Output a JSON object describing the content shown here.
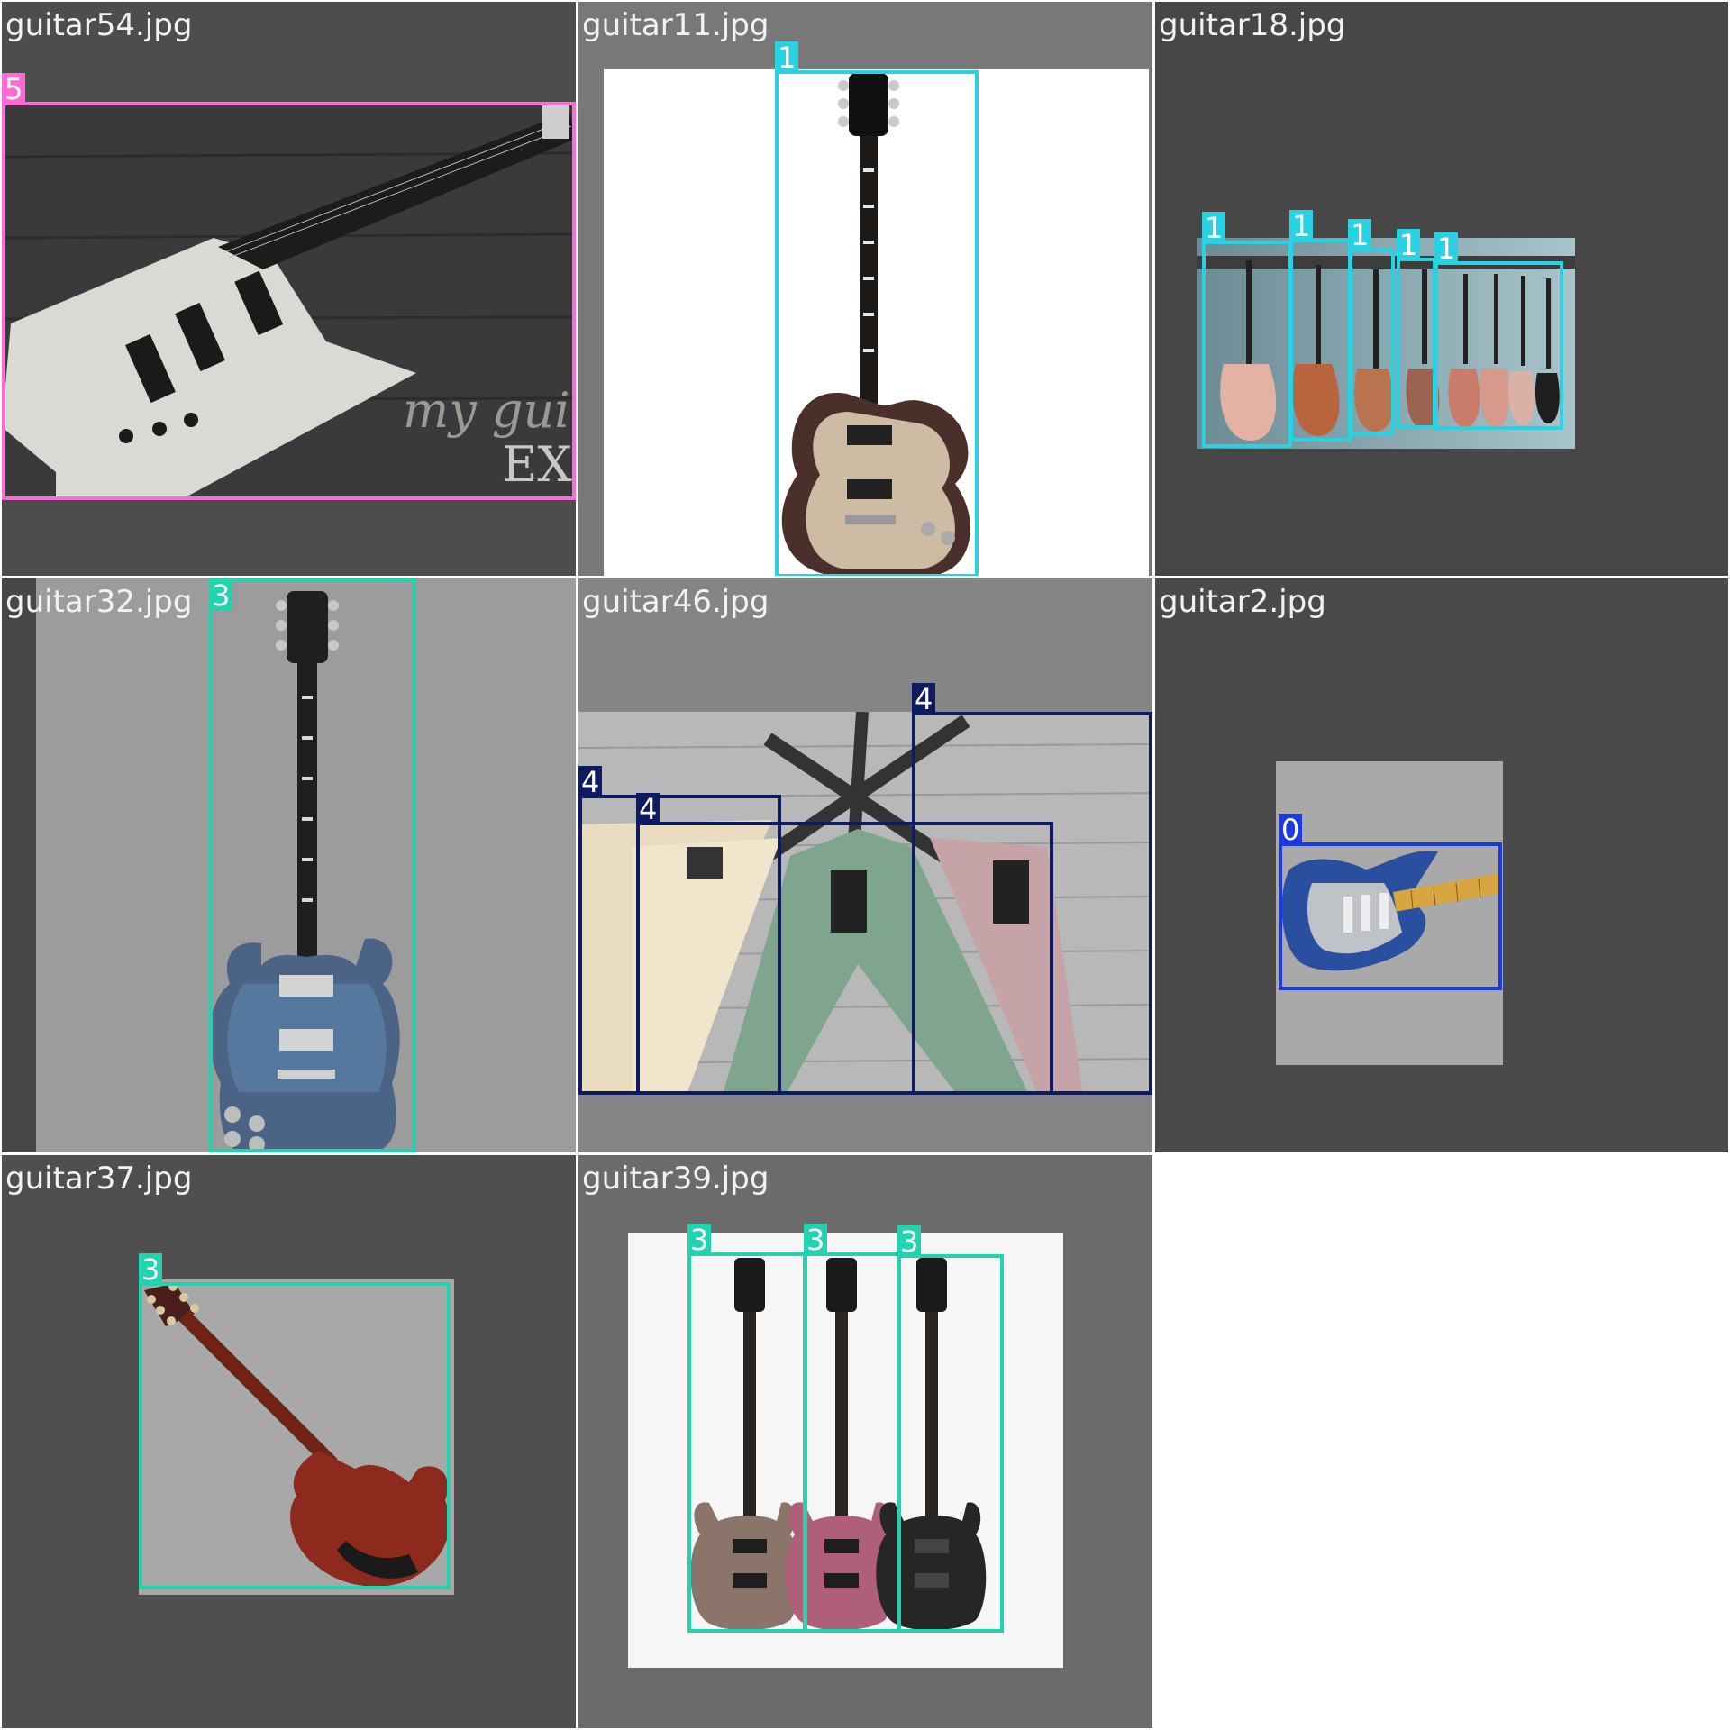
{
  "grid": {
    "background": "#ffffff",
    "tiles": [
      {
        "filename": "guitar54.jpg",
        "background": "#4d4d4d",
        "image": {
          "content": "white-explorer-guitar-on-dark-wood",
          "background": "#3b3b3b"
        },
        "boxes": [
          {
            "class_id": "5",
            "color": "#ff6bd6"
          }
        ]
      },
      {
        "filename": "guitar11.jpg",
        "background": "#787878",
        "image": {
          "content": "sunburst-les-paul-guitar-on-white",
          "background": "#ffffff"
        },
        "boxes": [
          {
            "class_id": "1",
            "color": "#28d2e0"
          }
        ]
      },
      {
        "filename": "guitar18.jpg",
        "background": "#474747",
        "image": {
          "content": "row-of-guitars-hanging-on-wall",
          "background": "#6f8e98"
        },
        "boxes": [
          {
            "class_id": "1",
            "color": "#28d2e0"
          },
          {
            "class_id": "1",
            "color": "#28d2e0"
          },
          {
            "class_id": "1",
            "color": "#28d2e0"
          },
          {
            "class_id": "1",
            "color": "#28d2e0"
          },
          {
            "class_id": "1",
            "color": "#28d2e0"
          }
        ]
      },
      {
        "filename": "guitar32.jpg",
        "background": "#474747",
        "image": {
          "content": "blue-burst-sg-guitar-on-grey",
          "background": "#9c9c9c"
        },
        "boxes": [
          {
            "class_id": "3",
            "color": "#21d3ae"
          }
        ]
      },
      {
        "filename": "guitar46.jpg",
        "background": "#858585",
        "image": {
          "content": "three-flying-v-guitars-on-wood",
          "background": "#b9b9b9"
        },
        "boxes": [
          {
            "class_id": "4",
            "color": "#0e1b5e"
          },
          {
            "class_id": "4",
            "color": "#0e1b5e"
          },
          {
            "class_id": "4",
            "color": "#0e1b5e"
          }
        ]
      },
      {
        "filename": "guitar2.jpg",
        "background": "#4a4a4a",
        "image": {
          "content": "blue-stratocaster-guitar",
          "background": "#a9a9a9"
        },
        "boxes": [
          {
            "class_id": "0",
            "color": "#1d3ae0"
          }
        ]
      },
      {
        "filename": "guitar37.jpg",
        "background": "#4f4f4f",
        "image": {
          "content": "red-sg-guitar-back-view",
          "background": "#a8a8a8"
        },
        "boxes": [
          {
            "class_id": "3",
            "color": "#21d3ae"
          }
        ]
      },
      {
        "filename": "guitar39.jpg",
        "background": "#6b6b6b",
        "image": {
          "content": "three-sg-guitars-brown-pink-black",
          "background": "#f5f5f5"
        },
        "boxes": [
          {
            "class_id": "3",
            "color": "#21d3ae"
          },
          {
            "class_id": "3",
            "color": "#21d3ae"
          },
          {
            "class_id": "3",
            "color": "#21d3ae"
          }
        ]
      }
    ]
  }
}
